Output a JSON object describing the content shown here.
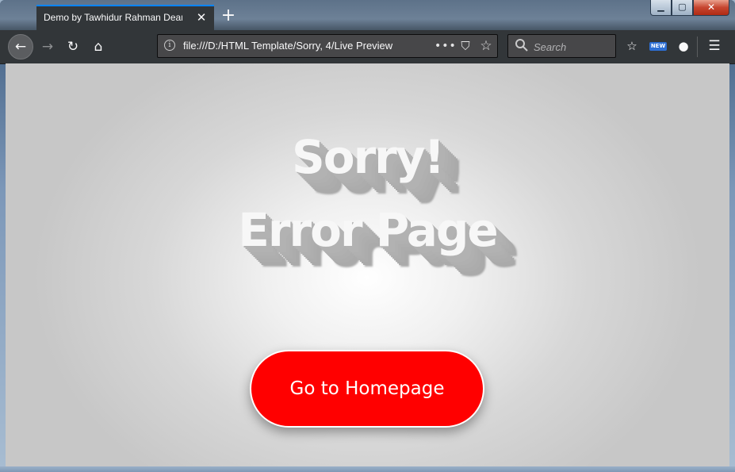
{
  "browser": {
    "tab": {
      "title": "Demo by Tawhidur Rahman Dear. P",
      "close_glyph": "✕"
    },
    "newtab_glyph": "+",
    "window_controls": {
      "minimize": "▁",
      "maximize": "▢",
      "close": "✕"
    },
    "nav": {
      "back_glyph": "←",
      "forward_glyph": "→",
      "reload_glyph": "↻",
      "home_glyph": "⌂"
    },
    "urlbar": {
      "info_glyph": "i",
      "url": "file:///D:/HTML Template/Sorry, 4/Live Preview",
      "more_glyph": "•••",
      "pocket_glyph": "⛉",
      "star_glyph": "☆"
    },
    "search": {
      "placeholder": "Search"
    },
    "toolbar": {
      "library_glyph": "☆",
      "new_badge": "NEW",
      "account_glyph": "●",
      "menu_glyph": "☰"
    }
  },
  "page": {
    "heading_line1": "Sorry!",
    "heading_line2": "Error Page",
    "home_button_label": "Go to Homepage",
    "colors": {
      "button_bg": "#ff0000",
      "button_text": "#ffffff",
      "heading_text": "#f7f7f7",
      "heading_shadow": "#aaaaaa"
    }
  }
}
